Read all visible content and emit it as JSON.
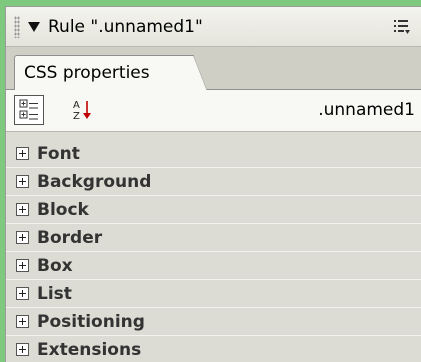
{
  "panel": {
    "title": "Rule \".unnamed1\"",
    "tab_label": "CSS properties",
    "selector_name": ".unnamed1"
  },
  "toolbar": {
    "category_view_icon": "category-view-icon",
    "sort_az_icon": "sort-az-icon"
  },
  "categories": [
    {
      "label": "Font"
    },
    {
      "label": "Background"
    },
    {
      "label": "Block"
    },
    {
      "label": "Border"
    },
    {
      "label": "Box"
    },
    {
      "label": "List"
    },
    {
      "label": "Positioning"
    },
    {
      "label": "Extensions"
    }
  ]
}
